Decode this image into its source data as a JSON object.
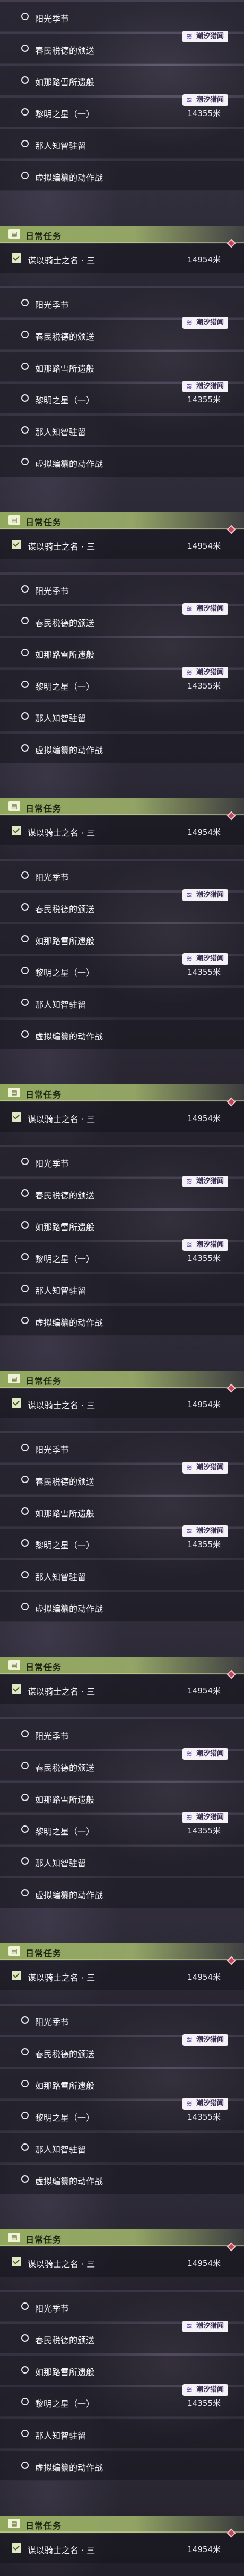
{
  "panel_repeats": 9,
  "quests": [
    {
      "name": "阳光季节",
      "distance": "",
      "badge": ""
    },
    {
      "name": "春民税德的颁送",
      "distance": "",
      "badge": "潮汐猎闻"
    },
    {
      "name": "如那路雪所遗般",
      "distance": "",
      "badge": ""
    },
    {
      "name": "黎明之星（一）",
      "distance": "14355米",
      "badge": "潮汐猎闻"
    },
    {
      "name": "那人知智驻留",
      "distance": "",
      "badge": ""
    },
    {
      "name": "虚拟编纂的动作战",
      "distance": "",
      "badge": ""
    }
  ],
  "daily_header": {
    "title": "日常任务",
    "icon": "book-icon"
  },
  "daily_quest": {
    "name": "谋以骑士之名 · 三",
    "distance": "14954米"
  },
  "colors": {
    "header_green": "#9aaf5f",
    "badge_bg": "#f4f1f7",
    "badge_text": "#3a2f53",
    "marker_red": "#c0455a"
  }
}
